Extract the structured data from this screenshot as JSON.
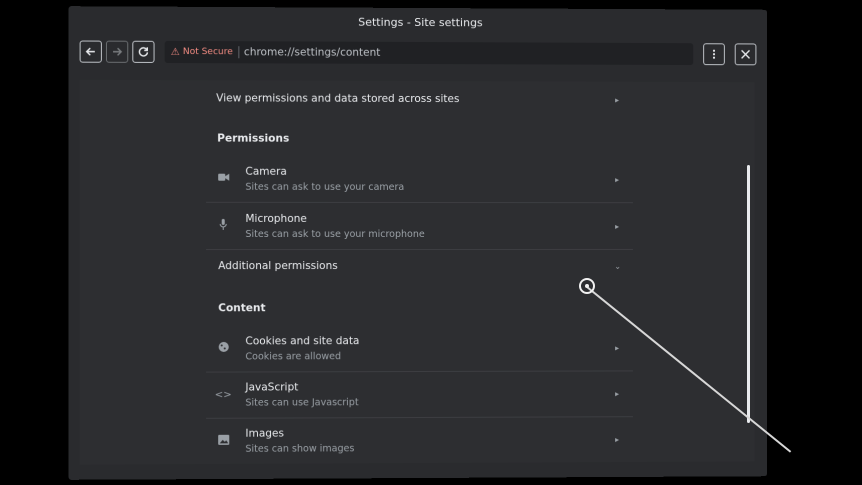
{
  "window": {
    "title": "Settings - Site settings"
  },
  "toolbar": {
    "back_icon": "arrow-left-icon",
    "forward_icon": "arrow-right-icon",
    "reload_icon": "reload-icon",
    "security_label": "Not Secure",
    "url": "chrome://settings/content",
    "menu_icon": "kebab-menu-icon",
    "close_icon": "close-icon"
  },
  "content": {
    "view_permissions": "View permissions and data stored across sites",
    "permissions_header": "Permissions",
    "permissions": [
      {
        "title": "Camera",
        "subtitle": "Sites can ask to use your camera",
        "icon": "camera-icon"
      },
      {
        "title": "Microphone",
        "subtitle": "Sites can ask to use your microphone",
        "icon": "microphone-icon"
      }
    ],
    "additional_permissions": "Additional permissions",
    "content_header": "Content",
    "content_items": [
      {
        "title": "Cookies and site data",
        "subtitle": "Cookies are allowed",
        "icon": "cookie-icon"
      },
      {
        "title": "JavaScript",
        "subtitle": "Sites can use Javascript",
        "icon": "code-icon"
      },
      {
        "title": "Images",
        "subtitle": "Sites can show images",
        "icon": "image-icon"
      }
    ]
  }
}
